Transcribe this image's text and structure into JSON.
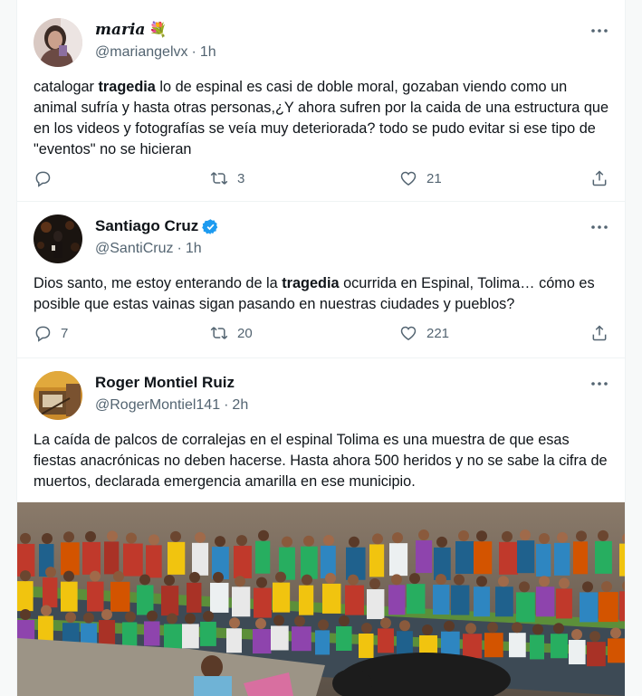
{
  "tweets": [
    {
      "name": "maria",
      "name_emoji": "💐",
      "handle": "@mariangelvx",
      "time": "1h",
      "text_before": "catalogar ",
      "text_bold": "tragedia",
      "text_after": " lo de espinal es casi de doble moral, gozaban viendo como un animal sufría y hasta otras personas,¿Y ahora sufren por la caida de una estructura que en los videos y fotografías se veía muy deteriorada? todo se pudo evitar si ese tipo de \"eventos\" no se hicieran",
      "replies": "",
      "retweets": "3",
      "likes": "21"
    },
    {
      "name": "Santiago Cruz",
      "handle": "@SantiCruz",
      "time": "1h",
      "text_before": "Dios santo, me estoy enterando de la ",
      "text_bold": "tragedia",
      "text_after": " ocurrida en Espinal, Tolima… cómo es posible que estas vainas sigan pasando en nuestras ciudades y pueblos?",
      "replies": "7",
      "retweets": "20",
      "likes": "221"
    },
    {
      "name": "Roger Montiel Ruiz",
      "handle": "@RogerMontiel141",
      "time": "2h",
      "text": "La caída de palcos de corralejas en el espinal Tolima es una muestra de que esas fiestas anacrónicas no deben hacerse. Hasta ahora 500 heridos y no se sabe la cifra de muertos, declarada emergencia amarilla en ese municipio."
    }
  ],
  "separator": "·",
  "icons": [
    "more-icon",
    "reply-icon",
    "retweet-icon",
    "like-icon",
    "share-icon",
    "verified-icon"
  ],
  "colors": {
    "text": "#0f1419",
    "secondary": "#536471",
    "verified": "#1d9bf0",
    "divider": "#eff3f4"
  }
}
